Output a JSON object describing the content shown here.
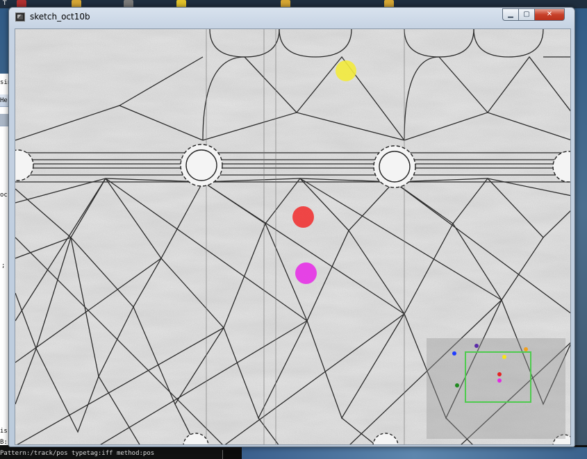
{
  "desktop": {
    "taskbar_label": "T",
    "bg_window_labels": [
      "sin",
      "He",
      "oc",
      ";",
      "is",
      "B:"
    ],
    "console_line": "Pattern:/track/pos typetag:iff method:pos"
  },
  "window": {
    "title": "sketch_oct10b",
    "controls": {
      "minimize": "▁",
      "maximize": "▢",
      "close": "✕"
    }
  },
  "tracked_blobs": [
    {
      "name": "yellow-blob",
      "color": "#f2ea3c"
    },
    {
      "name": "red-blob",
      "color": "#ef3d3d"
    },
    {
      "name": "magenta-blob",
      "color": "#e63ae6"
    }
  ],
  "minimap": {
    "roi_color": "#4ecb4e",
    "dots": [
      {
        "name": "minimap-dot-blue",
        "color": "#1f3cff"
      },
      {
        "name": "minimap-dot-purple",
        "color": "#5b2aa8"
      },
      {
        "name": "minimap-dot-orange",
        "color": "#f2a01e"
      },
      {
        "name": "minimap-dot-yellow",
        "color": "#f7e21a"
      },
      {
        "name": "minimap-dot-red",
        "color": "#e52323"
      },
      {
        "name": "minimap-dot-magenta",
        "color": "#e22be2"
      },
      {
        "name": "minimap-dot-green",
        "color": "#1f8a1f"
      }
    ]
  }
}
